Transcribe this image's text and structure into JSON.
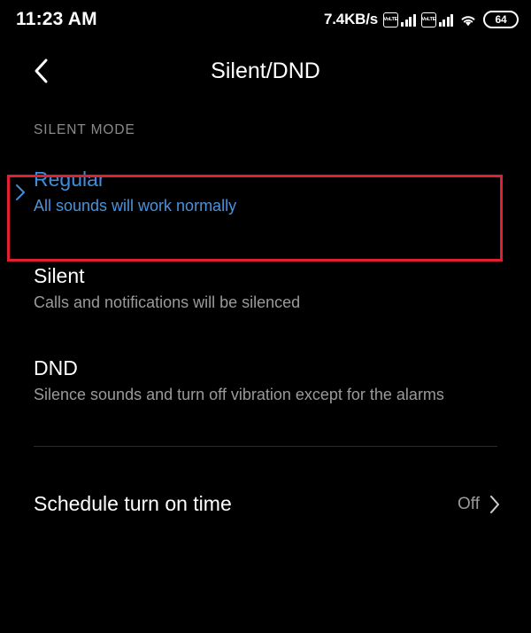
{
  "statusbar": {
    "time": "11:23 AM",
    "network_speed": "7.4KB/s",
    "sim1_label": "VoLTE",
    "sim2_label": "VoLTE",
    "wifi_icon": "wifi-icon",
    "battery_level": "64"
  },
  "appbar": {
    "back_icon": "chevron-left-icon",
    "title": "Silent/DND"
  },
  "section": {
    "label": "SILENT MODE"
  },
  "modes": [
    {
      "title": "Regular",
      "subtitle": "All sounds will work normally",
      "selected": true,
      "chevron_icon": "chevron-right-icon"
    },
    {
      "title": "Silent",
      "subtitle": "Calls and notifications will be silenced",
      "selected": false
    },
    {
      "title": "DND",
      "subtitle": "Silence sounds and turn off vibration except for the alarms",
      "selected": false
    }
  ],
  "schedule": {
    "label": "Schedule turn on time",
    "value": "Off",
    "chevron_icon": "chevron-right-icon"
  },
  "annotation": {
    "color": "#e02030",
    "target": "Regular"
  },
  "colors": {
    "background": "#000000",
    "accent_blue": "#3d8fdd",
    "secondary_text": "#9a9a9a",
    "section_text": "#8a8a8a",
    "annotation_red": "#e02030"
  }
}
